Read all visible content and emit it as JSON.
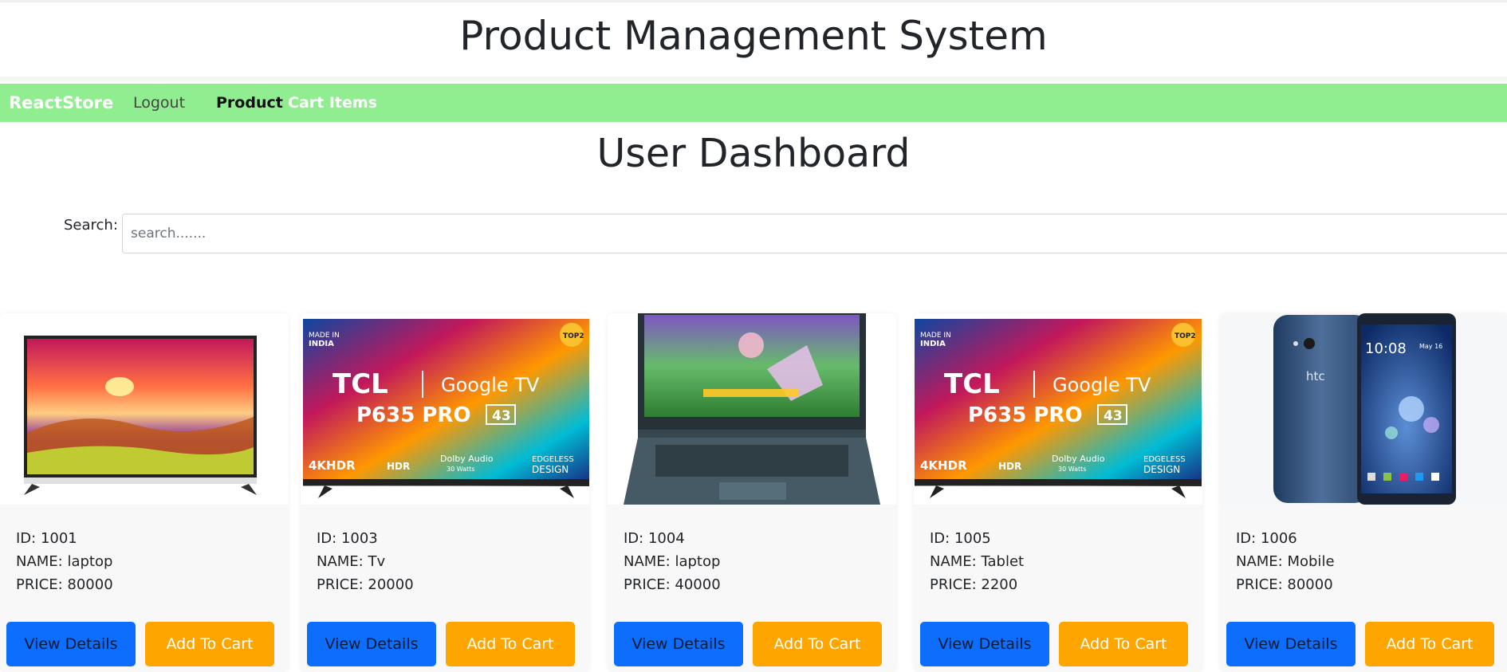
{
  "app": {
    "title": "Product Management System"
  },
  "nav": {
    "brand": "ReactStore",
    "logout": "Logout",
    "product": "Product",
    "cart_items": "Cart Items",
    "bg_color": "#90ee90"
  },
  "dashboard": {
    "title": "User Dashboard"
  },
  "search": {
    "label": "Search:",
    "placeholder": "search.......",
    "value": ""
  },
  "products": [
    {
      "id_label": "ID: 1001",
      "name_label": "NAME: laptop",
      "price_label": "PRICE: 80000",
      "image": "tv-landscape-image"
    },
    {
      "id_label": "ID: 1003",
      "name_label": "NAME: Tv",
      "price_label": "PRICE: 20000",
      "image": "tcl-google-tv-image"
    },
    {
      "id_label": "ID: 1004",
      "name_label": "NAME: laptop",
      "price_label": "PRICE: 40000",
      "image": "gaming-laptop-image"
    },
    {
      "id_label": "ID: 1005",
      "name_label": "NAME: Tablet",
      "price_label": "PRICE: 2200",
      "image": "tcl-google-tv-image"
    },
    {
      "id_label": "ID: 1006",
      "name_label": "NAME: Mobile",
      "price_label": "PRICE: 80000",
      "image": "htc-phone-image"
    }
  ],
  "tv_promo": {
    "made_in": "MADE IN",
    "india": "INDIA",
    "top_badge": "TOP2",
    "brand": "TCL",
    "google_tv": "Google TV",
    "model": "P635 PRO",
    "size": "43",
    "hdr_4k": "4KHDR",
    "hdr": "HDR",
    "dolby": "Dolby Audio",
    "watts": "30 Watts",
    "edgeless": "EDGELESS",
    "design": "DESIGN"
  },
  "phone_screen": {
    "brand": "htc",
    "time": "10:08",
    "date": "May 16"
  },
  "buttons": {
    "view_details": "View Details",
    "add_to_cart": "Add To Cart"
  },
  "colors": {
    "primary": "#0d6efd",
    "warning": "#ffa500"
  }
}
